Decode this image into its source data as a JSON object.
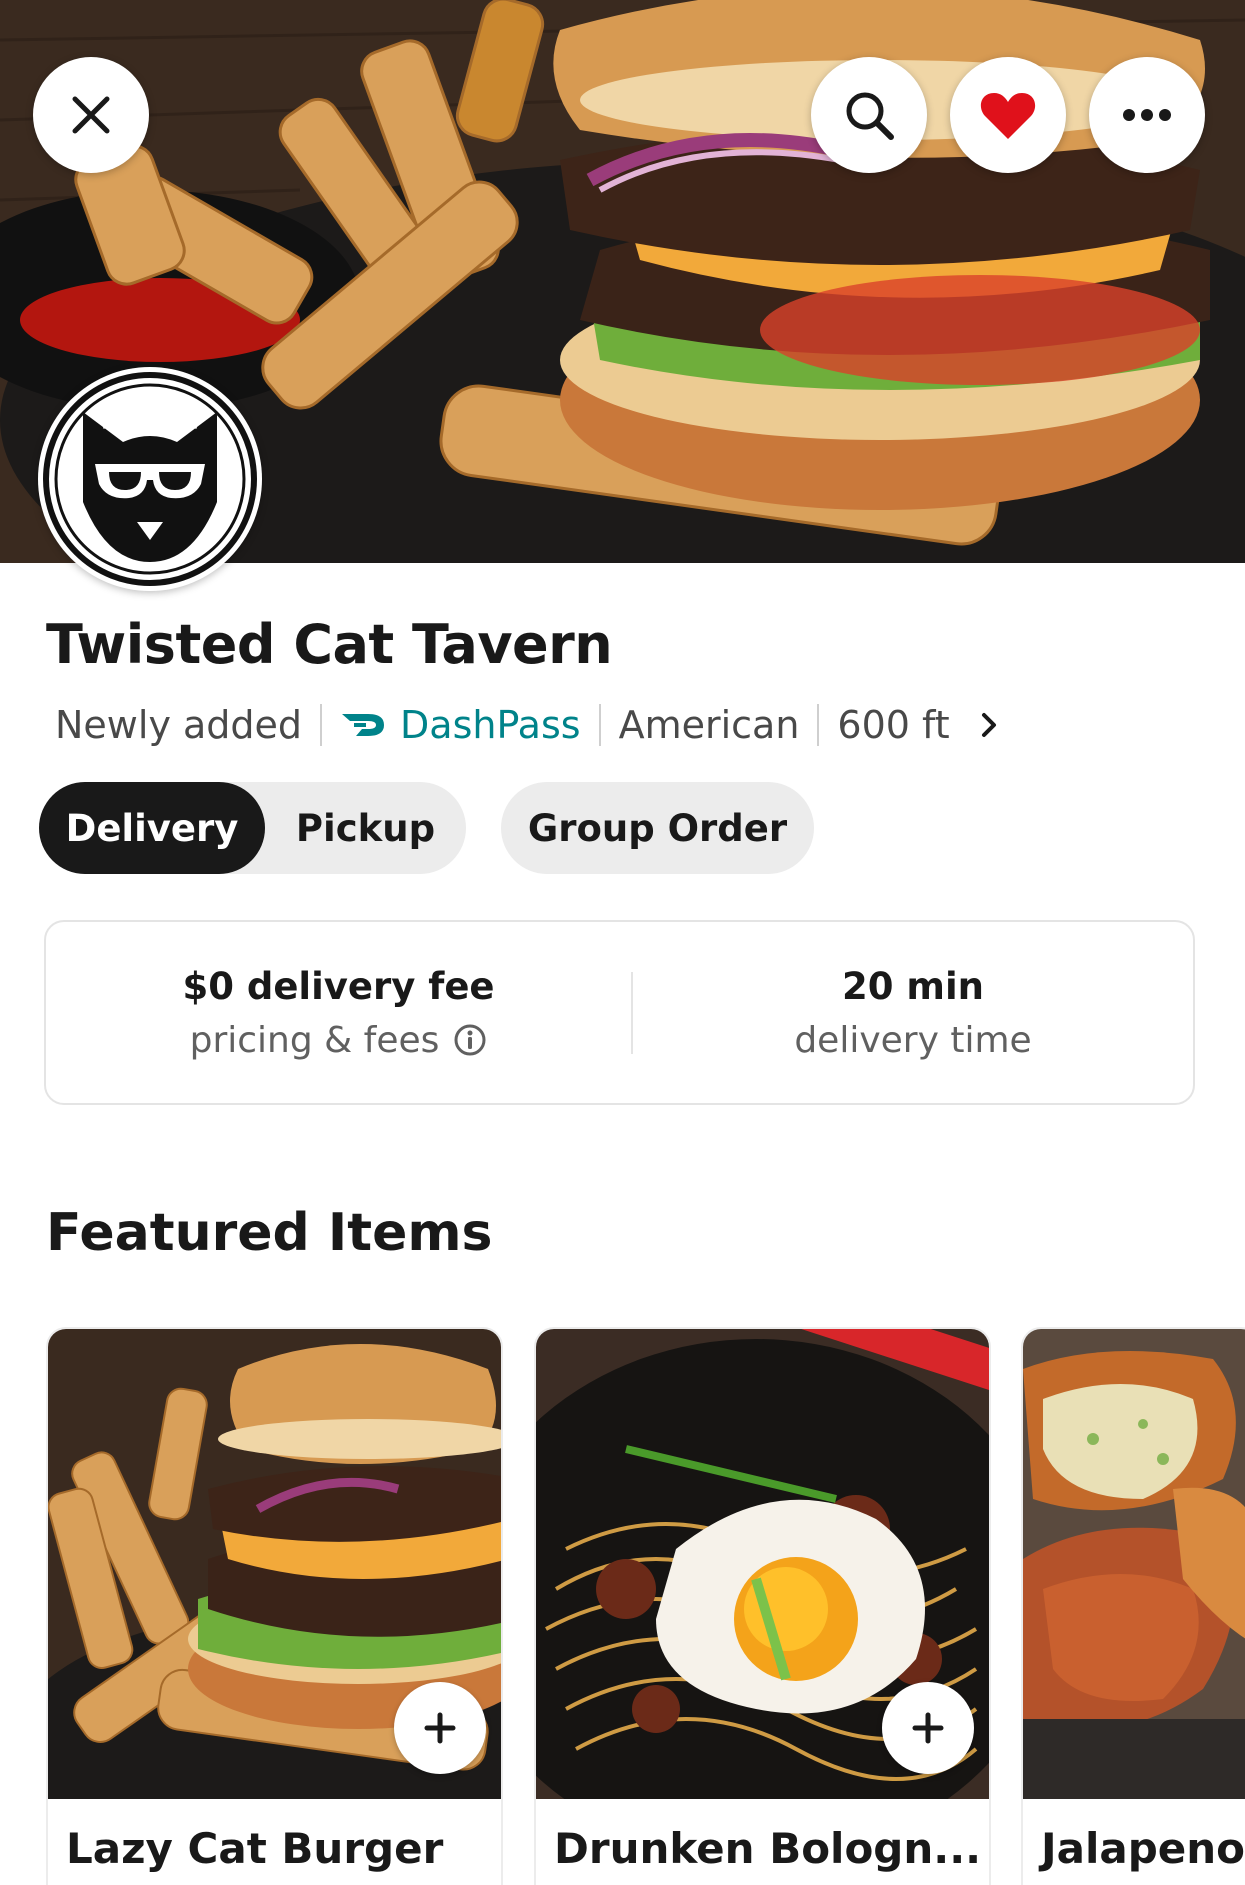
{
  "header": {
    "close_icon": "close-icon",
    "search_icon": "search-icon",
    "heart_icon": "heart-icon",
    "more_icon": "more-icon",
    "heart_color": "#e0111b"
  },
  "store": {
    "name": "Twisted Cat Tavern",
    "meta": {
      "badge": "Newly added",
      "dashpass": "DashPass",
      "cuisine": "American",
      "distance": "600 ft"
    }
  },
  "mode_toggle": {
    "options": [
      "Delivery",
      "Pickup"
    ],
    "selected": "Delivery"
  },
  "group_order_label": "Group Order",
  "fees": {
    "fee_title": "$0 delivery fee",
    "fee_sub": "pricing & fees",
    "time_title": "20 min",
    "time_sub": "delivery time"
  },
  "featured": {
    "title": "Featured Items",
    "items": [
      {
        "name": "Lazy Cat Burger"
      },
      {
        "name": "Drunken Bologn..."
      },
      {
        "name": "Jalapeno"
      }
    ]
  },
  "colors": {
    "accent_dashpass": "#00838a",
    "selected_toggle": "#191919",
    "chip_bg": "#ececec"
  }
}
